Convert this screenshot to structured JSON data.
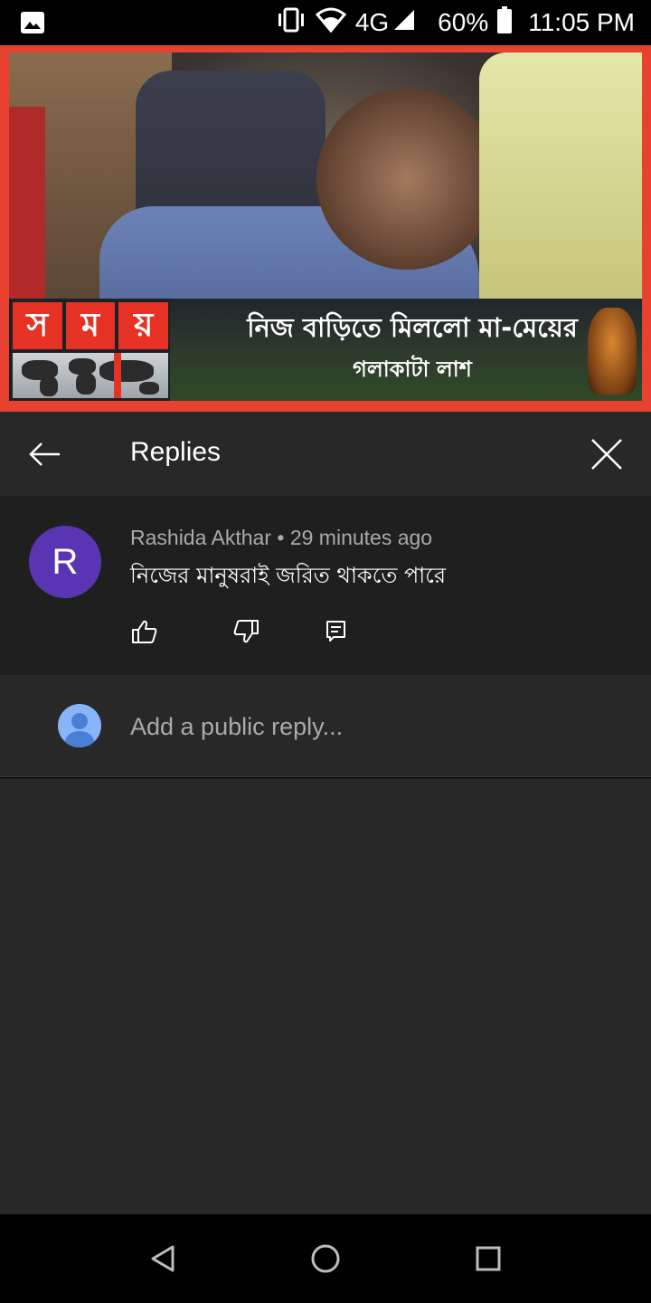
{
  "status_bar": {
    "network": "4G",
    "battery": "60%",
    "time": "11:05 PM",
    "icons": [
      "image-icon",
      "vibrate-icon",
      "wifi-icon",
      "signal-icon",
      "battery-icon"
    ]
  },
  "video": {
    "channel_logo": [
      "স",
      "ম",
      "য়"
    ],
    "headline_line1": "নিজ বাড়িতে মিললো মা-মেয়ের",
    "headline_line2": "গলাকাটা লাশ"
  },
  "replies_panel": {
    "title": "Replies"
  },
  "comment": {
    "avatar_letter": "R",
    "author": "Rashida Akthar",
    "separator": "•",
    "time": "29 minutes ago",
    "text": "নিজের মানুষরাই জরিত থাকতে পারে"
  },
  "reply_input": {
    "placeholder": "Add a public reply..."
  },
  "colors": {
    "accent_red": "#e63224",
    "avatar_purple": "#5a35b3",
    "user_avatar_blue": "#8ab4f8",
    "panel_bg": "#282828",
    "comment_bg": "#1f1f1f"
  }
}
